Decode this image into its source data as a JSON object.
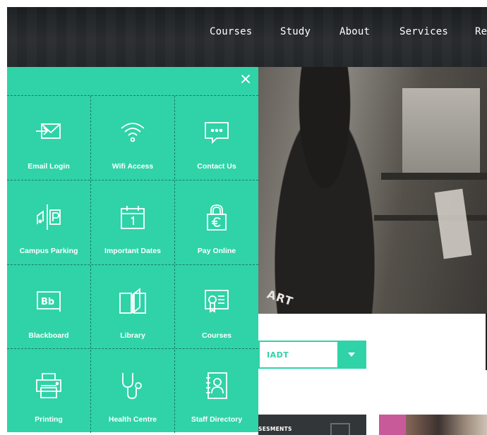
{
  "nav": {
    "items": [
      "Courses",
      "Study",
      "About",
      "Services",
      "Re"
    ]
  },
  "hero": {
    "shirt_text": "ART"
  },
  "dropdown": {
    "value": "IADT",
    "arrow_icon": "caret-down-icon"
  },
  "cards": {
    "dark_title": "SESMENTS"
  },
  "quick_links": {
    "close_icon": "close-icon",
    "items": [
      {
        "label": "Email Login",
        "icon": "email-login-icon"
      },
      {
        "label": "Wifi Access",
        "icon": "wifi-icon"
      },
      {
        "label": "Contact Us",
        "icon": "chat-bubble-icon"
      },
      {
        "label": "Campus Parking",
        "icon": "parking-icon"
      },
      {
        "label": "Important Dates",
        "icon": "calendar-icon"
      },
      {
        "label": "Pay Online",
        "icon": "padlock-euro-icon"
      },
      {
        "label": "Blackboard",
        "icon": "blackboard-icon"
      },
      {
        "label": "Library",
        "icon": "book-icon"
      },
      {
        "label": "Courses",
        "icon": "certificate-icon"
      },
      {
        "label": "Printing",
        "icon": "printer-icon"
      },
      {
        "label": "Health Centre",
        "icon": "stethoscope-icon"
      },
      {
        "label": "Staff Directory",
        "icon": "address-book-icon"
      }
    ]
  },
  "colors": {
    "accent": "#2fd3a7",
    "nav_bg": "#24272a",
    "dark_card": "#333638"
  }
}
